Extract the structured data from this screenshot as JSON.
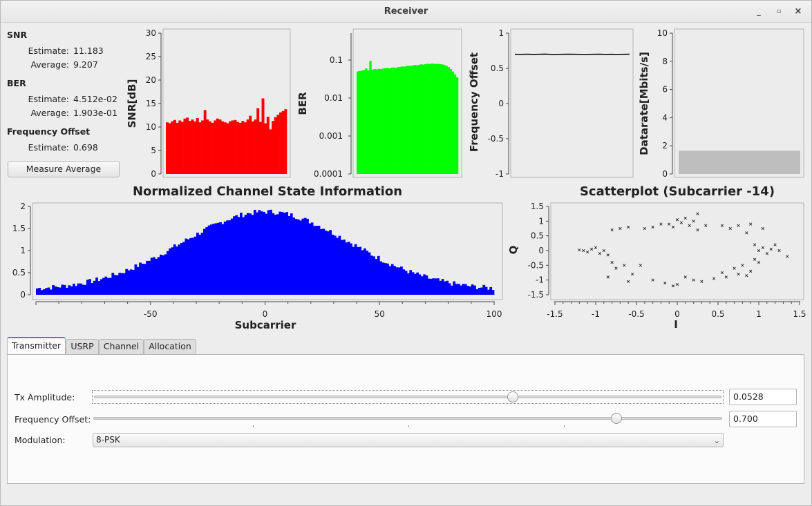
{
  "window": {
    "title": "Receiver"
  },
  "stats": {
    "snr_title": "SNR",
    "snr_estimate_label": "Estimate:",
    "snr_estimate": "11.183",
    "snr_average_label": "Average:",
    "snr_average": "9.207",
    "ber_title": "BER",
    "ber_estimate_label": "Estimate:",
    "ber_estimate": "4.512e-02",
    "ber_average_label": "Average:",
    "ber_average": "1.903e-01",
    "fo_title": "Frequency Offset",
    "fo_estimate_label": "Estimate:",
    "fo_estimate": "0.698",
    "measure_button": "Measure Average"
  },
  "colors": {
    "snr": "#ff0000",
    "ber": "#00ff00",
    "csi": "#0000ff",
    "datarate": "#bebebe",
    "accent": "#3584e4"
  },
  "chart_data": [
    {
      "type": "bar",
      "ylabel": "SNR[dB]",
      "ylim": [
        0,
        30
      ],
      "yticks": [
        "0",
        "5",
        "10",
        "15",
        "20",
        "25",
        "30"
      ],
      "description_series": "per-subcarrier SNR, 48 subcarriers",
      "values": [
        11.0,
        10.8,
        11.2,
        11.5,
        10.9,
        11.4,
        11.1,
        11.8,
        12.0,
        11.3,
        11.6,
        11.2,
        11.9,
        11.0,
        11.4,
        13.6,
        11.6,
        11.2,
        10.9,
        11.4,
        11.8,
        11.6,
        11.2,
        11.0,
        10.8,
        11.2,
        11.4,
        11.5,
        11.1,
        10.9,
        11.3,
        11.0,
        11.6,
        12.4,
        11.2,
        11.6,
        14.0,
        11.1,
        16.1,
        10.8,
        12.2,
        9.5,
        11.3,
        12.1,
        12.6,
        13.1,
        13.4,
        13.8
      ]
    },
    {
      "type": "bar",
      "ylabel": "BER",
      "yscale": "log",
      "ylim": [
        0.0001,
        0.5
      ],
      "yticks": [
        "0.0001",
        "0.001",
        "0.01",
        "0.1"
      ],
      "values": [
        0.05,
        0.052,
        0.053,
        0.055,
        0.06,
        0.053,
        0.095,
        0.056,
        0.058,
        0.057,
        0.059,
        0.058,
        0.06,
        0.061,
        0.062,
        0.06,
        0.063,
        0.064,
        0.062,
        0.065,
        0.066,
        0.068,
        0.067,
        0.07,
        0.071,
        0.07,
        0.072,
        0.074,
        0.073,
        0.075,
        0.077,
        0.076,
        0.078,
        0.08,
        0.079,
        0.081,
        0.08,
        0.079,
        0.08,
        0.078,
        0.077,
        0.074,
        0.07,
        0.065,
        0.058,
        0.05,
        0.042,
        0.035
      ]
    },
    {
      "type": "line",
      "ylabel": "Frequency Offset",
      "ylim": [
        -1,
        1
      ],
      "yticks": [
        "1",
        "0.5",
        "0",
        "-0.5",
        "-1"
      ],
      "values": [
        0.7,
        0.699,
        0.701,
        0.698,
        0.7,
        0.702,
        0.699,
        0.698,
        0.7,
        0.701,
        0.7,
        0.699,
        0.698,
        0.7,
        0.701,
        0.699,
        0.7,
        0.698,
        0.7,
        0.701
      ]
    },
    {
      "type": "bar",
      "ylabel": "Datarate[Mbits/s]",
      "ylim": [
        0,
        10
      ],
      "yticks": [
        "0",
        "2",
        "4",
        "6",
        "8",
        "10"
      ],
      "values": [
        1.65
      ]
    },
    {
      "type": "bar",
      "title": "Normalized Channel State Information",
      "xlabel": "Subcarrier",
      "xlim": [
        -100,
        100
      ],
      "ylim": [
        0,
        2
      ],
      "xticks": [
        "-50",
        "0",
        "50",
        "100"
      ],
      "yticks": [
        "0",
        "0.5",
        "1",
        "1.5",
        "2"
      ]
    },
    {
      "type": "scatter",
      "title": "Scatterplot (Subcarrier -14)",
      "xlabel": "I",
      "ylabel": "Q",
      "xlim": [
        -1.5,
        1.5
      ],
      "ylim": [
        -1.5,
        1.5
      ],
      "xticks": [
        "-1.5",
        "-1",
        "-0.5",
        "0",
        "0.5",
        "1",
        "1.5"
      ],
      "yticks": [
        "1.5",
        "1",
        "0.5",
        "0",
        "-0.5",
        "-1",
        "-1.5"
      ],
      "points": [
        [
          -1.15,
          0.0
        ],
        [
          -1.1,
          -0.05
        ],
        [
          -1.2,
          0.02
        ],
        [
          -1.05,
          0.05
        ],
        [
          -0.95,
          -0.1
        ],
        [
          -0.9,
          0.0
        ],
        [
          -0.85,
          -0.15
        ],
        [
          -1.0,
          0.1
        ],
        [
          -0.8,
          -0.4
        ],
        [
          -0.75,
          -0.6
        ],
        [
          -0.85,
          -0.9
        ],
        [
          -0.65,
          -0.5
        ],
        [
          -0.55,
          -0.8
        ],
        [
          -0.6,
          -1.05
        ],
        [
          -0.45,
          -0.5
        ],
        [
          -0.8,
          0.7
        ],
        [
          -0.7,
          0.75
        ],
        [
          -0.6,
          0.8
        ],
        [
          -0.4,
          0.75
        ],
        [
          -0.3,
          0.8
        ],
        [
          -0.1,
          0.9
        ],
        [
          0.0,
          1.05
        ],
        [
          0.1,
          1.1
        ],
        [
          0.2,
          1.0
        ],
        [
          -0.05,
          0.8
        ],
        [
          0.15,
          0.85
        ],
        [
          0.35,
          0.85
        ],
        [
          0.25,
          1.25
        ],
        [
          -0.15,
          -1.1
        ],
        [
          0.0,
          -1.15
        ],
        [
          0.1,
          -0.9
        ],
        [
          0.2,
          -1.0
        ],
        [
          0.3,
          -1.05
        ],
        [
          0.45,
          -0.95
        ],
        [
          -0.3,
          -1.0
        ],
        [
          -0.05,
          -1.2
        ],
        [
          0.55,
          -0.75
        ],
        [
          0.6,
          -0.9
        ],
        [
          0.7,
          -0.6
        ],
        [
          0.75,
          -0.8
        ],
        [
          0.85,
          -0.85
        ],
        [
          0.8,
          -0.5
        ],
        [
          0.95,
          -0.3
        ],
        [
          0.9,
          -0.7
        ],
        [
          1.0,
          -0.4
        ],
        [
          0.65,
          0.75
        ],
        [
          0.75,
          0.85
        ],
        [
          0.85,
          0.6
        ],
        [
          0.9,
          0.9
        ],
        [
          1.05,
          0.75
        ],
        [
          0.55,
          0.85
        ],
        [
          0.95,
          0.2
        ],
        [
          1.05,
          0.1
        ],
        [
          1.15,
          0.05
        ],
        [
          1.25,
          0.0
        ],
        [
          1.2,
          0.2
        ],
        [
          1.35,
          -0.2
        ],
        [
          1.1,
          -0.1
        ],
        [
          1.0,
          0.0
        ],
        [
          -0.2,
          0.9
        ],
        [
          0.05,
          0.95
        ],
        [
          0.25,
          0.7
        ]
      ]
    }
  ],
  "tabs": [
    {
      "label": "Transmitter",
      "active": true
    },
    {
      "label": "USRP",
      "active": false
    },
    {
      "label": "Channel",
      "active": false
    },
    {
      "label": "Allocation",
      "active": false
    }
  ],
  "transmitter": {
    "tx_amplitude_label": "Tx Amplitude:",
    "tx_amplitude_value": "0.0528",
    "tx_amplitude_fraction": 0.67,
    "frequency_offset_label": "Frequency Offset:",
    "frequency_offset_value": "0.700",
    "frequency_offset_fraction": 0.84,
    "modulation_label": "Modulation:",
    "modulation_value": "8-PSK"
  }
}
